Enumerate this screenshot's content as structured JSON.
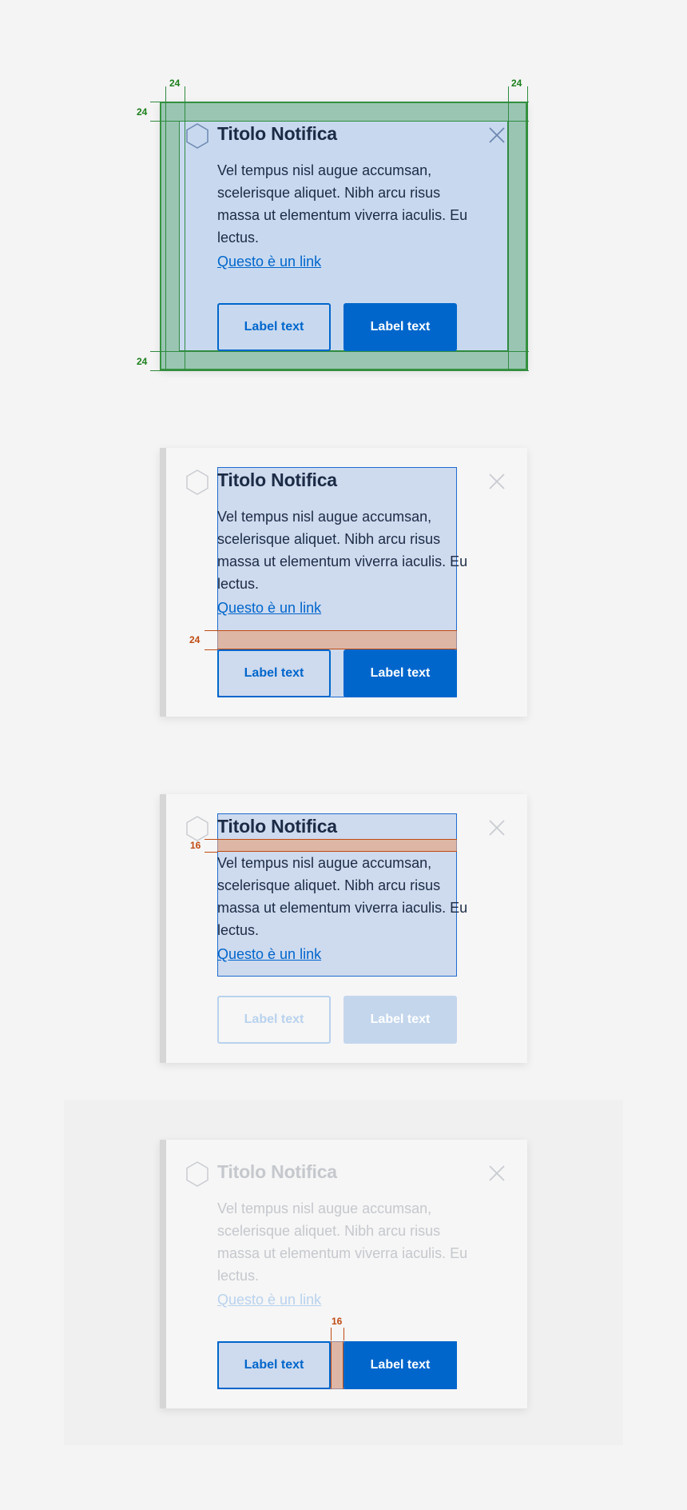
{
  "notification": {
    "title": "Titolo Notifica",
    "body": "Vel tempus nisl augue accumsan, scelerisque aliquet. Nibh arcu risus massa ut elementum viverra iaculis. Eu lectus.",
    "link": "Questo è un link",
    "primary_button": "Label text",
    "secondary_button": "Label text",
    "icon": "hexagon-icon",
    "close_icon": "close-icon"
  },
  "annotations": {
    "padding_top_left": "24",
    "padding_top_right": "24",
    "padding_left": "24",
    "padding_bottom": "24",
    "link_to_buttons_gap": "24",
    "title_to_body_gap": "16",
    "button_gap": "16"
  },
  "colors": {
    "accent": "#0066cc",
    "padding_highlight": "#a9d2a6",
    "spacing_highlight": "#e9b9a0",
    "content_highlight": "#c8d9ef"
  }
}
